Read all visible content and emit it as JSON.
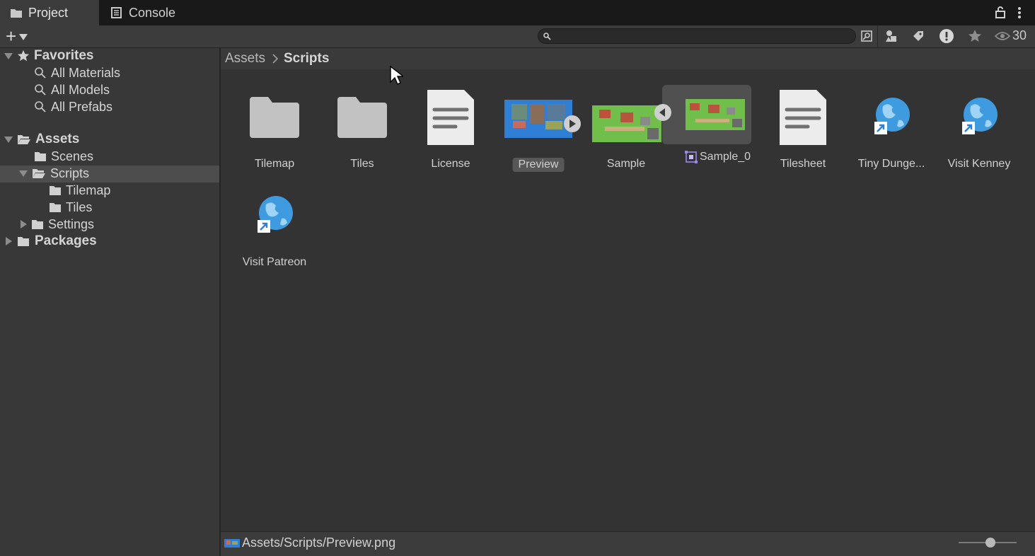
{
  "tabs": [
    {
      "label": "Project",
      "icon": "folder-icon"
    },
    {
      "label": "Console",
      "icon": "console-icon"
    }
  ],
  "toolbar": {
    "add_label": "+",
    "visible_count": "30",
    "search_placeholder": ""
  },
  "sidebar": {
    "favorites": {
      "label": "Favorites",
      "items": [
        "All Materials",
        "All Models",
        "All Prefabs"
      ]
    },
    "assets": {
      "label": "Assets",
      "scenes": "Scenes",
      "scripts": "Scripts",
      "tilemap": "Tilemap",
      "tiles": "Tiles",
      "settings": "Settings"
    },
    "packages": "Packages"
  },
  "breadcrumb": {
    "root": "Assets",
    "current": "Scripts"
  },
  "items": [
    {
      "label": "Tilemap",
      "type": "folder"
    },
    {
      "label": "Tiles",
      "type": "folder"
    },
    {
      "label": "License",
      "type": "text"
    },
    {
      "label": "Preview",
      "type": "image",
      "selected": true
    },
    {
      "label": "Sample",
      "type": "image"
    },
    {
      "label": "Sample_0",
      "type": "sprite"
    },
    {
      "label": "Tilesheet",
      "type": "text"
    },
    {
      "label": "Tiny Dunge...",
      "type": "url"
    },
    {
      "label": "Visit Kenney",
      "type": "url"
    },
    {
      "label": "Visit Patreon",
      "type": "url"
    }
  ],
  "status": {
    "path": "Assets/Scripts/Preview.png",
    "zoom_fraction": 0.55
  },
  "colors": {
    "panel": "#383838",
    "main": "#333333",
    "selection": "#4d4d4d",
    "accent": "#2f7fd6"
  }
}
